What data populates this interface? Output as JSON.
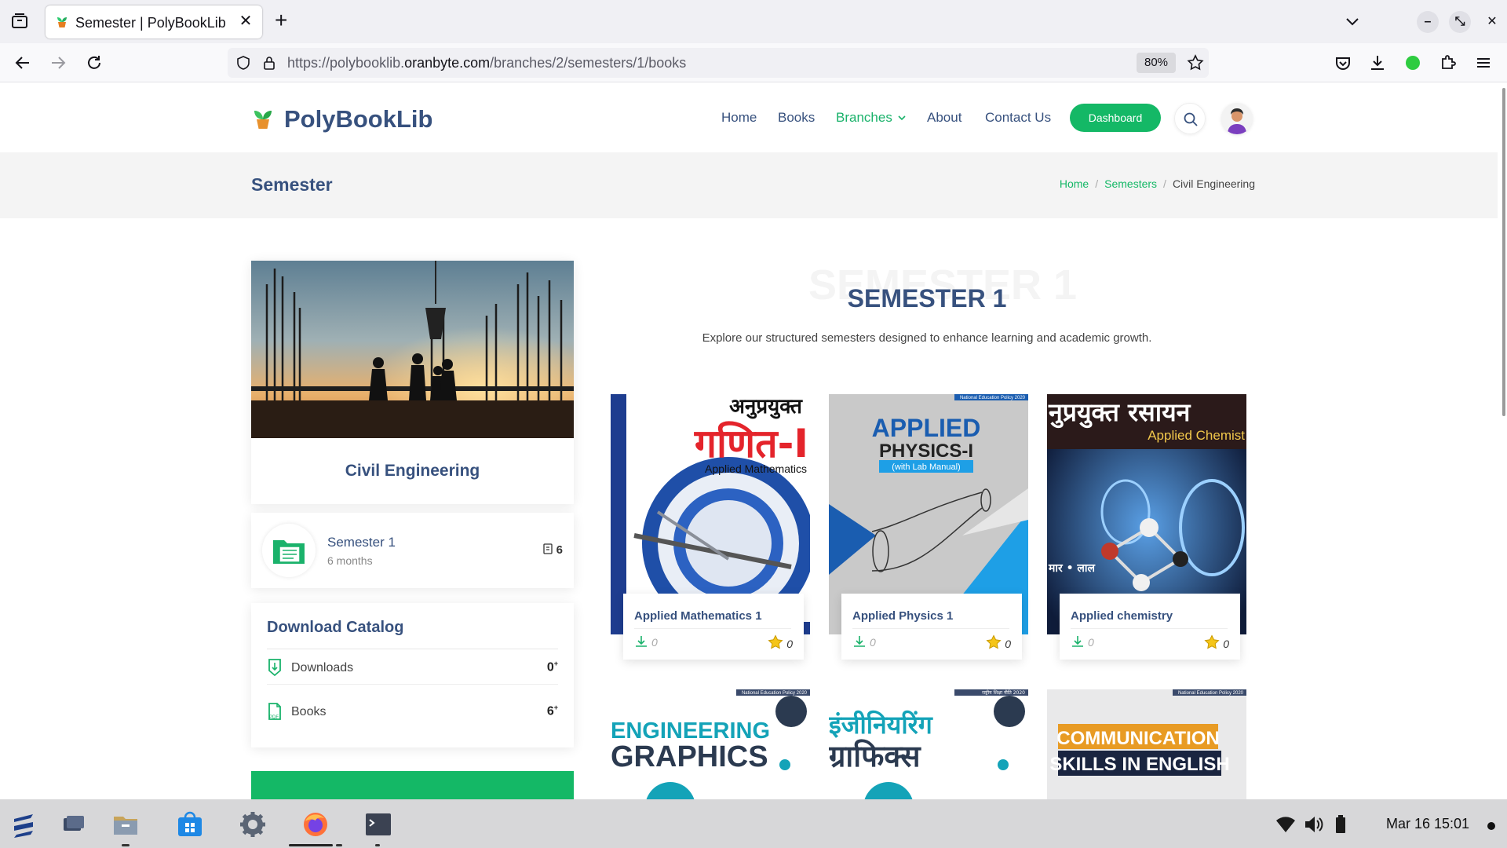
{
  "browser": {
    "tab_title": "Semester | PolyBookLib",
    "url_prefix": "https://polybooklib.",
    "url_host": "oranbyte.com",
    "url_path": "/branches/2/semesters/1/books",
    "zoom": "80%"
  },
  "site": {
    "logo": "PolyBookLib",
    "nav": {
      "home": "Home",
      "books": "Books",
      "branches": "Branches",
      "about": "About",
      "contact": "Contact Us",
      "dashboard": "Dashboard"
    }
  },
  "page_title": "Semester",
  "breadcrumb": {
    "home": "Home",
    "semesters": "Semesters",
    "current": "Civil Engineering"
  },
  "sidebar": {
    "branch_name": "Civil Engineering",
    "semester_title": "Semester 1",
    "semester_duration": "6 months",
    "semester_book_count": "6",
    "catalog": {
      "title": "Download Catalog",
      "downloads_label": "Downloads",
      "downloads_value": "0",
      "books_label": "Books",
      "books_value": "6",
      "suffix": "+"
    }
  },
  "content": {
    "bg_text": "SEMESTER 1",
    "heading": "SEMESTER 1",
    "description": "Explore our structured semesters designed to enhance learning and academic growth.",
    "books": [
      {
        "title": "Applied Mathematics 1",
        "downloads": "0",
        "rating": "0",
        "cover_hindi": "अनुप्रयुक्त",
        "cover_big": "गणित-I",
        "cover_sub": "Applied Mathematics"
      },
      {
        "title": "Applied Physics 1",
        "downloads": "0",
        "rating": "0",
        "cover_l1": "APPLIED",
        "cover_l2": "PHYSICS-I",
        "cover_sub": "(with Lab Manual)",
        "cover_tag": "National Education Policy 2020"
      },
      {
        "title": "Applied chemistry",
        "downloads": "0",
        "rating": "0",
        "cover_hindi": "नुप्रयुक्त रसायन",
        "cover_sub": "Applied Chemist",
        "cover_author": "मार • लाल"
      }
    ],
    "books_row2": [
      {
        "l1": "ENGINEERING",
        "l2": "GRAPHICS",
        "tag": "National Education Policy 2020"
      },
      {
        "l1": "इंजीनियरिंग",
        "l2": "ग्राफिक्स",
        "tag": "राष्ट्रीय शिक्षा नीति 2020"
      },
      {
        "l1": "COMMUNICATION",
        "l2": "SKILLS IN ENGLISH",
        "tag": "National Education Policy 2020"
      }
    ]
  },
  "taskbar": {
    "clock": "Mar 16  15:01"
  },
  "colors": {
    "accent": "#14b866",
    "heading": "#37517e"
  }
}
